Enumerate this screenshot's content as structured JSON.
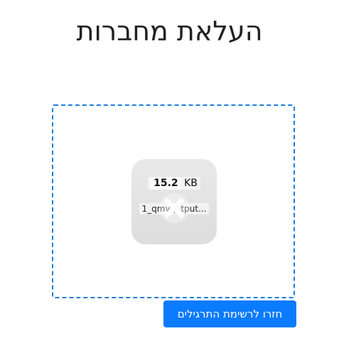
{
  "page": {
    "title": "העלאת מחברות"
  },
  "dropzone": {
    "border_color": "#1f7fdb",
    "file": {
      "size_value": "15.2",
      "size_unit": "KB",
      "name": "1_qmvqi.tput...",
      "remove_icon": "remove-x-icon"
    }
  },
  "actions": {
    "back_label": "חזרו לרשימת התרגילים",
    "back_color": "#0b7bff"
  }
}
